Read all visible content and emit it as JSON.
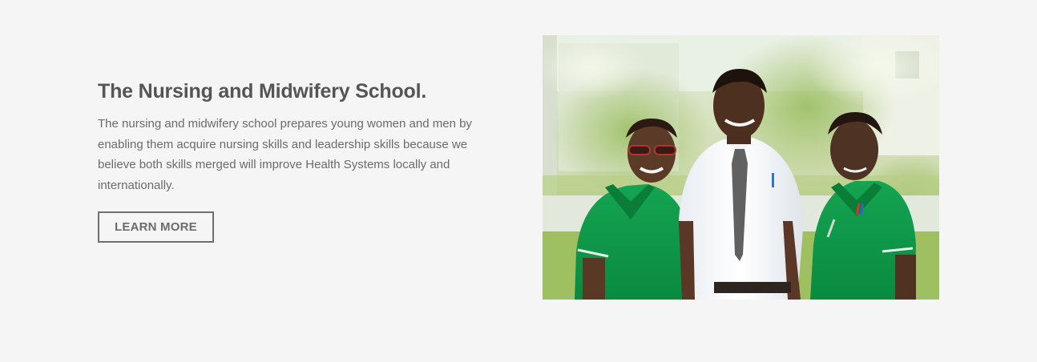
{
  "feature": {
    "title": "The Nursing and Midwifery School.",
    "description": "The nursing and midwifery school prepares young women and men by enabling them acquire nursing skills and leadership skills because we believe both skills merged will improve Health Systems locally and internationally.",
    "button_label": "LEARN MORE"
  },
  "colors": {
    "background": "#f5f5f5",
    "heading": "#555555",
    "body_text": "#6b6b6b",
    "button_border": "#6f6f6f",
    "uniform_green": "#0f9a4a"
  }
}
